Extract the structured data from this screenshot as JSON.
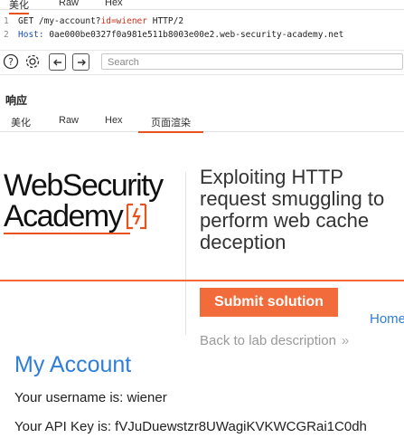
{
  "top_tabs": [
    {
      "label": "美化",
      "active": true
    },
    {
      "label": "Raw",
      "active": false
    },
    {
      "label": "Hex",
      "active": false
    }
  ],
  "request": {
    "line_numbers": [
      "1",
      "2"
    ],
    "line1_method": "GET /my-account?",
    "line1_param": "id=wiener",
    "line1_rest": " HTTP/2",
    "line2_key": "Host:",
    "line2_value": " 0ae000be0327f0a981e511b8003e00e2.web-security-academy.net"
  },
  "toolbar": {
    "search_placeholder": "Search",
    "icons": [
      "help-icon",
      "settings-icon",
      "back-arrow-icon",
      "forward-arrow-icon"
    ]
  },
  "response": {
    "title": "响应",
    "tabs": [
      {
        "label": "美化",
        "active": false
      },
      {
        "label": "Raw",
        "active": false
      },
      {
        "label": "Hex",
        "active": false
      },
      {
        "label": "页面渲染",
        "active": true
      }
    ]
  },
  "page": {
    "logo_line1": "WebSecurity",
    "logo_line2": "Academy",
    "lab_title": "Exploiting HTTP request smuggling to perform web cache deception",
    "submit_label": "Submit solution",
    "home_link": "Home",
    "back_link": "Back to lab description",
    "heading": "My Account",
    "username_line": "Your username is: wiener",
    "apikey_line": "Your API Key is: fVJuDuewstzr8UWagiKVKWCGRai1C0dh"
  },
  "colors": {
    "accent_orange": "#f26b3a",
    "link_blue": "#2f7ed8"
  }
}
